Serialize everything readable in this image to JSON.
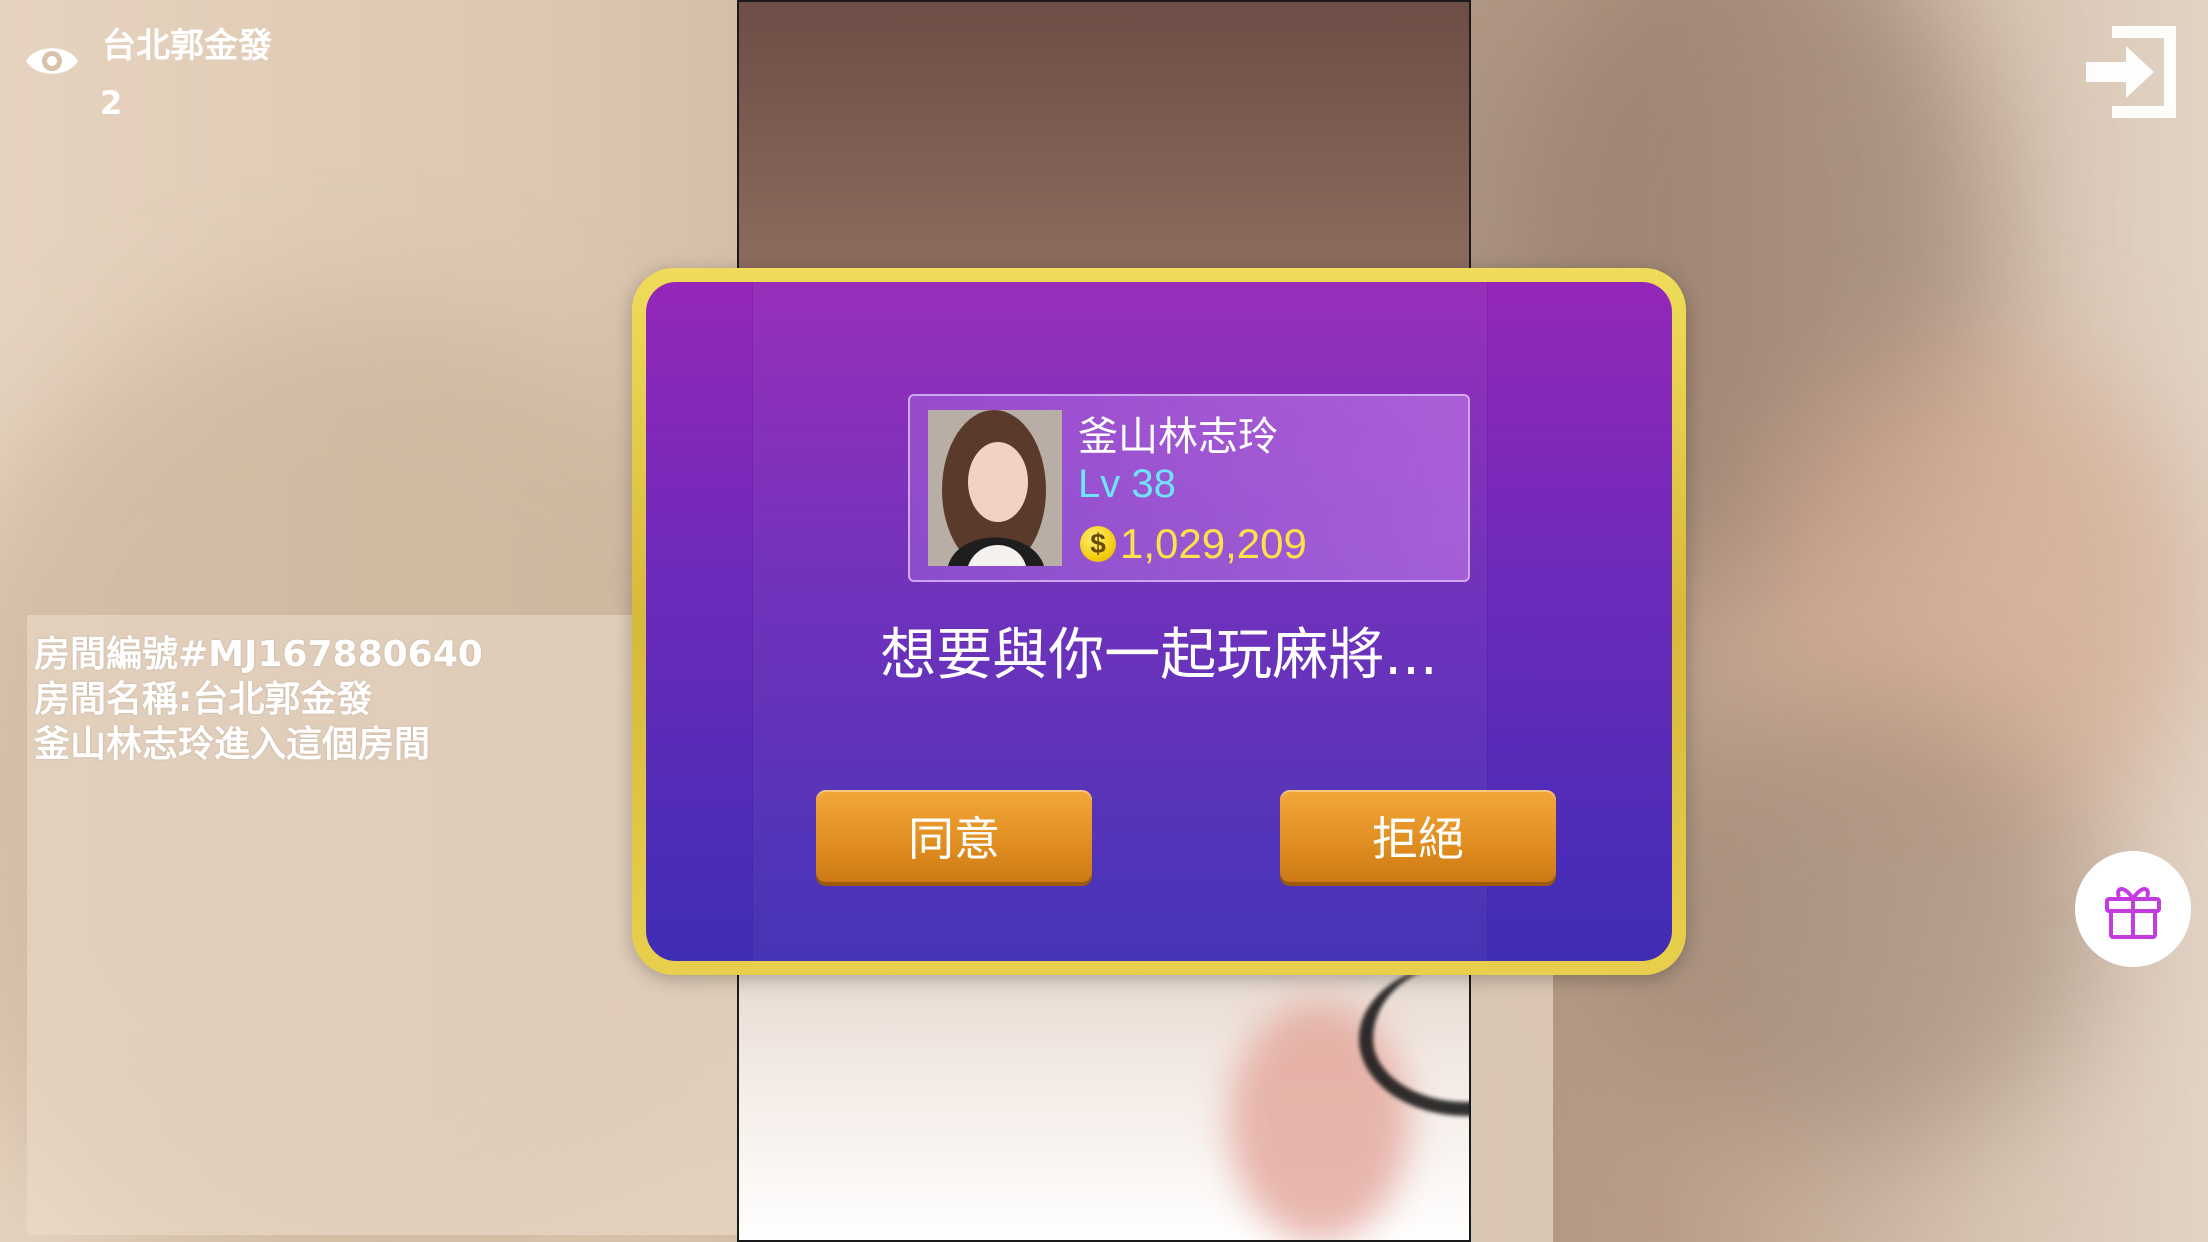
{
  "header": {
    "room_title": "台北郭金發",
    "viewer_count": "2"
  },
  "chat_log": [
    "房間編號#MJ167880640",
    "房間名稱:台北郭金發",
    "釜山林志玲進入這個房間"
  ],
  "dialog": {
    "player_name": "釜山林志玲",
    "player_level": "Lv 38",
    "coin_symbol": "$",
    "coin_amount": "1,029,209",
    "message": "想要與你一起玩麻將...",
    "agree_label": "同意",
    "reject_label": "拒絕"
  },
  "icons": {
    "viewers": "eye-icon",
    "exit": "exit-icon",
    "gift": "gift-icon",
    "coin": "coin-icon"
  },
  "colors": {
    "dialog_border": "#e6cc48",
    "dialog_top": "#9427b9",
    "dialog_bottom": "#3f2db4",
    "button_orange": "#e8992c",
    "level_cyan": "#6fe4ff",
    "coin_yellow": "#ffe14a",
    "gift_purple": "#c43ce0"
  }
}
